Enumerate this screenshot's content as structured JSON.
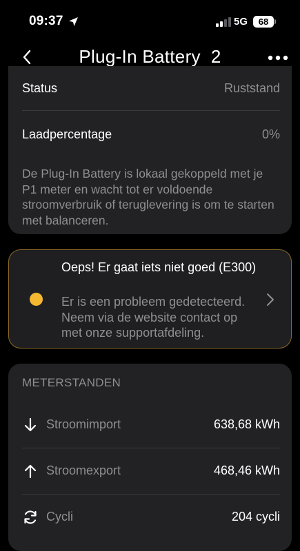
{
  "status_bar": {
    "time": "09:37",
    "network": "5G",
    "battery": "68"
  },
  "nav": {
    "title": "Plug-In Battery  2"
  },
  "status_card": {
    "rows": [
      {
        "label": "Status",
        "value": "Ruststand"
      },
      {
        "label": "Laadpercentage",
        "value": "0%"
      }
    ],
    "info": "De Plug-In Battery is lokaal gekoppeld met je P1 meter en wacht tot er voldoende stroomverbruik of teruglevering is om te starten met balanceren."
  },
  "alert": {
    "title": "Oeps! Er gaat iets niet goed (E300)",
    "description": "Er is een probleem gedetecteerd. Neem via de website contact op met onze supportafdeling.",
    "dot_color": "#f5b731"
  },
  "meter": {
    "section_title": "METERSTANDEN",
    "rows": [
      {
        "icon": "arrow-down-icon",
        "label": "Stroomimport",
        "value": "638,68 kWh"
      },
      {
        "icon": "arrow-up-icon",
        "label": "Stroomexport",
        "value": "468,46 kWh"
      },
      {
        "icon": "cycle-icon",
        "label": "Cycli",
        "value": "204 cycli"
      }
    ]
  },
  "colors": {
    "background": "#000000",
    "card": "#222224",
    "muted_text": "#8e8e93",
    "alert_border": "#8a6a2a",
    "warning": "#f5b731"
  }
}
